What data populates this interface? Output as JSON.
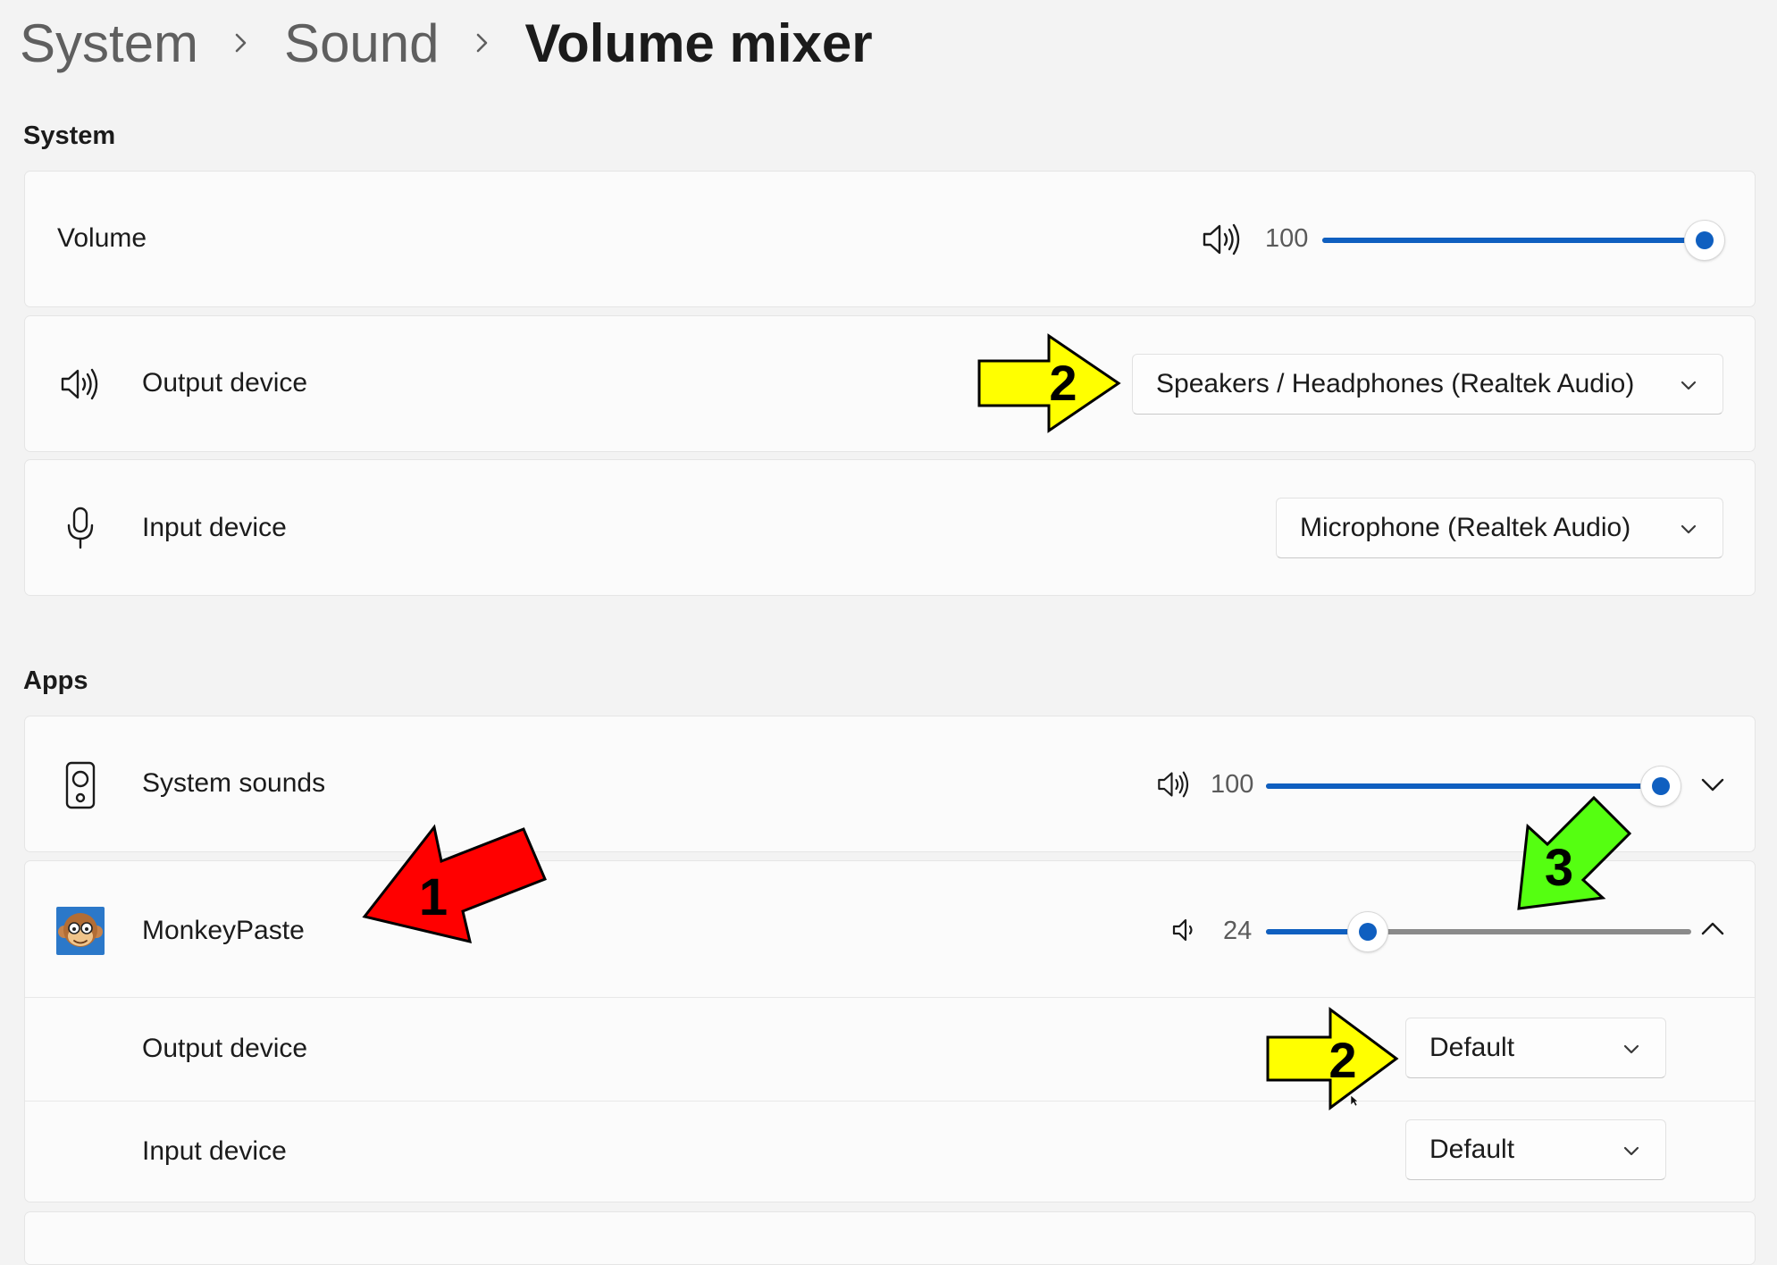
{
  "breadcrumb": {
    "items": [
      "System",
      "Sound"
    ],
    "current": "Volume mixer"
  },
  "system_section": {
    "title": "System",
    "volume": {
      "label": "Volume",
      "value": "100",
      "level": 1.0,
      "icon": "speaker-high-icon"
    },
    "output_device": {
      "label": "Output device",
      "selected": "Speakers / Headphones (Realtek Audio)",
      "icon": "speaker-high-icon"
    },
    "input_device": {
      "label": "Input device",
      "selected": "Microphone (Realtek Audio)",
      "icon": "microphone-icon"
    }
  },
  "apps_section": {
    "title": "Apps",
    "system_sounds": {
      "label": "System sounds",
      "value": "100",
      "level": 1.0,
      "icon": "speaker-box-icon"
    },
    "monkeypaste": {
      "label": "MonkeyPaste",
      "value": "24",
      "level": 0.24,
      "icon": "monkeypaste-app-icon",
      "output_device": {
        "label": "Output device",
        "selected": "Default"
      },
      "input_device": {
        "label": "Input device",
        "selected": "Default"
      }
    }
  },
  "annotations": {
    "arrow_1": "1",
    "arrow_2_top": "2",
    "arrow_2_bottom": "2",
    "arrow_3": "3"
  },
  "colors": {
    "accent": "#0f5fc0",
    "arrow_red": "#ff0000",
    "arrow_yellow": "#ffff00",
    "arrow_green": "#55ff11"
  }
}
